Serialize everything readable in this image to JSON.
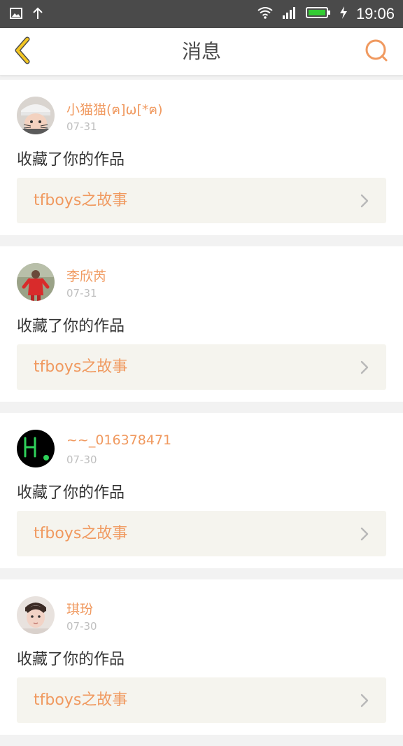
{
  "status_bar": {
    "time": "19:06",
    "icons": [
      "image-icon",
      "upload-icon",
      "wifi-icon",
      "signal-icon",
      "battery-icon",
      "charging-icon"
    ]
  },
  "header": {
    "title": "消息",
    "back_icon": "chevron-left-icon",
    "search_icon": "search-icon"
  },
  "colors": {
    "accent": "#f0995f",
    "back_icon_yellow": "#f3c622",
    "statusbar_bg": "#4a4a4a",
    "card_link_bg": "#f5f4ee",
    "page_bg": "#f2f2f2",
    "text_dark": "#333333",
    "text_muted": "#bfbfbf"
  },
  "notifications": [
    {
      "user": "小猫猫(ฅ]ω[*ฅ)",
      "date": "07-31",
      "action": "收藏了你的作品",
      "work": "tfboys之故事",
      "avatar": "user-avatar-photo"
    },
    {
      "user": "李欣芮",
      "date": "07-31",
      "action": "收藏了你的作品",
      "work": "tfboys之故事",
      "avatar": "user-avatar-photo"
    },
    {
      "user": "~~_016378471",
      "date": "07-30",
      "action": "收藏了你的作品",
      "work": "tfboys之故事",
      "avatar": "user-avatar-graffiti"
    },
    {
      "user": "琪玢",
      "date": "07-30",
      "action": "收藏了你的作品",
      "work": "tfboys之故事",
      "avatar": "user-avatar-photo"
    }
  ]
}
